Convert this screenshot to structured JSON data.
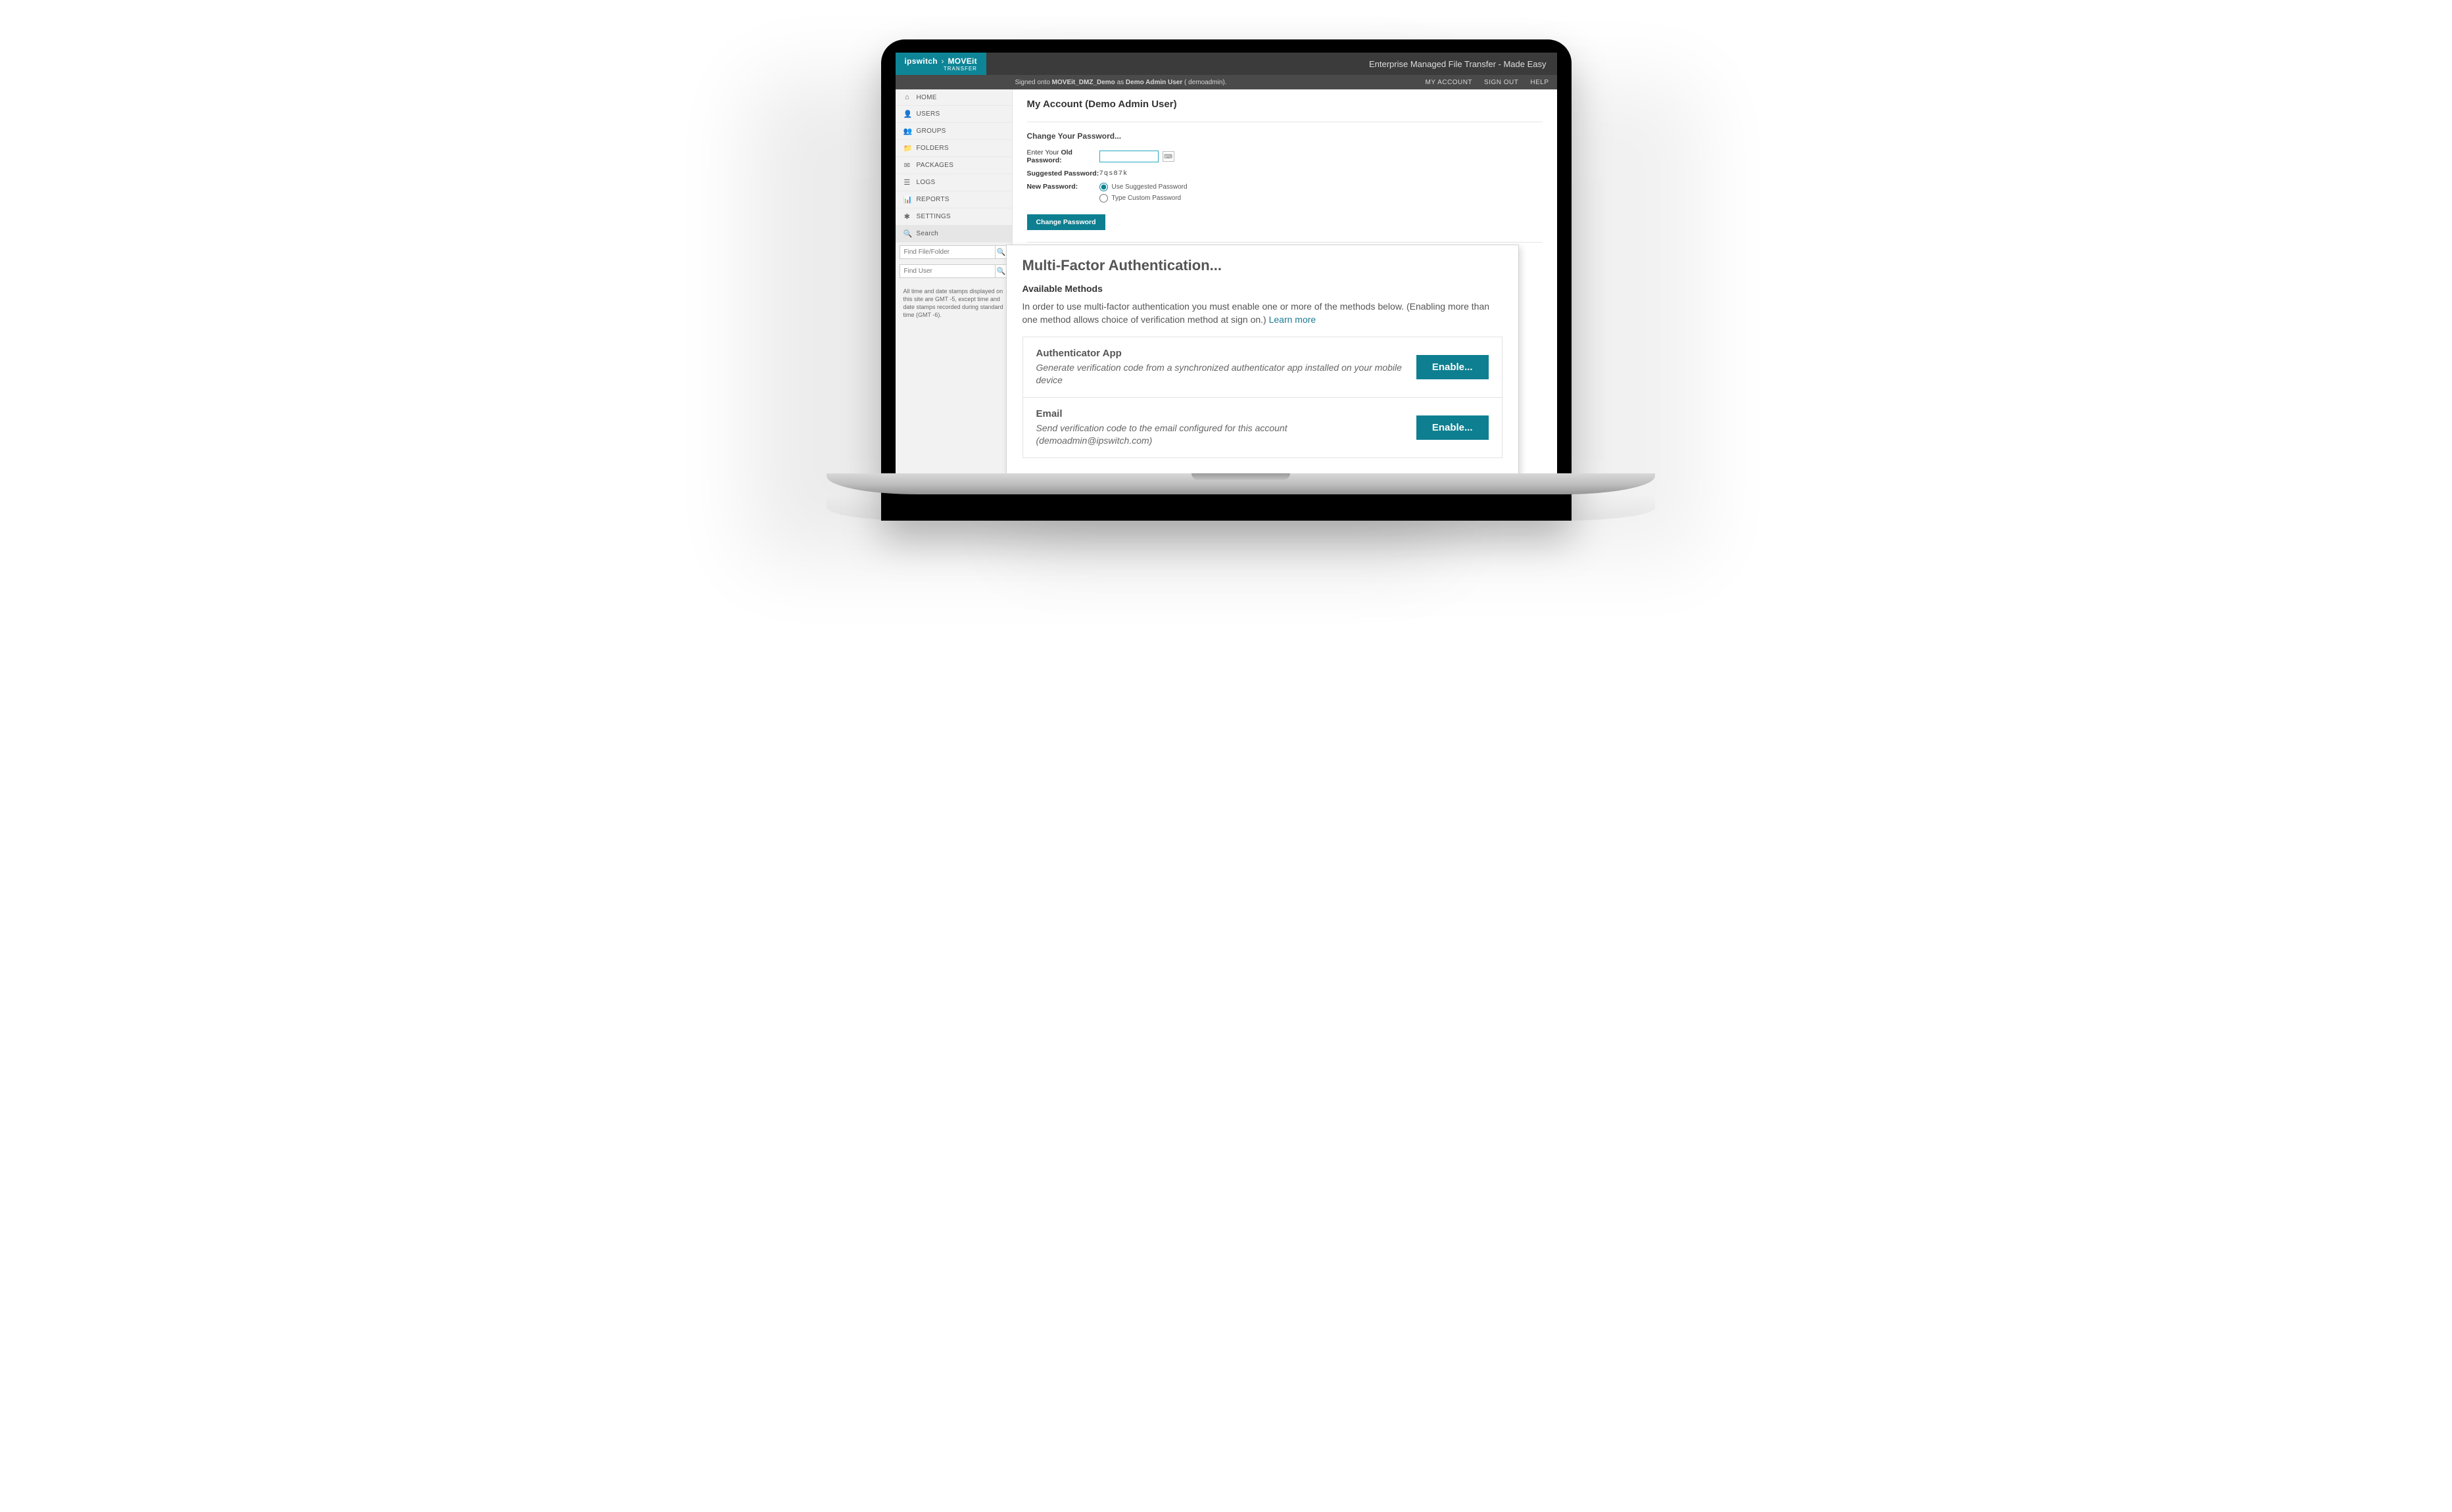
{
  "brand": {
    "line1a": "ipswitch",
    "line1b": "MOVEit",
    "line2": "TRANSFER"
  },
  "topbar_title": "Enterprise Managed File Transfer - Made Easy",
  "subbar": {
    "status_prefix": "Signed onto ",
    "status_org": "MOVEit_DMZ_Demo",
    "status_as": " as ",
    "status_user": "Demo Admin User",
    "status_paren": " ( demoadmin).",
    "links": {
      "account": "MY ACCOUNT",
      "signout": "SIGN OUT",
      "help": "HELP"
    }
  },
  "sidebar": {
    "items": [
      {
        "label": "HOME"
      },
      {
        "label": "USERS"
      },
      {
        "label": "GROUPS"
      },
      {
        "label": "FOLDERS"
      },
      {
        "label": "PACKAGES"
      },
      {
        "label": "LOGS"
      },
      {
        "label": "REPORTS"
      },
      {
        "label": "SETTINGS"
      }
    ],
    "search_label": "Search",
    "find_file_placeholder": "Find File/Folder",
    "find_user_placeholder": "Find User",
    "tz_note": "All time and date stamps displayed on this site are GMT -5, except time and date stamps recorded during standard time (GMT -6)."
  },
  "main": {
    "page_title": "My Account (Demo Admin User)",
    "change_pw_heading": "Change Your Password...",
    "old_pw_label_a": "Enter Your ",
    "old_pw_label_b": "Old Password:",
    "suggested_label": "Suggested Password:",
    "suggested_value": "7qs87k",
    "new_pw_label": "New Password:",
    "radio_use": "Use Suggested Password",
    "radio_custom": "Type Custom Password",
    "change_btn": "Change Password",
    "mfa_small_heading": "Multi-Factor Authentication..."
  },
  "mfa": {
    "title": "Multi-Factor Authentication...",
    "subheading": "Available Methods",
    "desc_a": "In order to use multi-factor authentication you must enable one or more of the methods below. (Enabling more than one method allows choice of verification method at sign on.) ",
    "learn_more": "Learn more",
    "methods": [
      {
        "name": "Authenticator App",
        "detail": "Generate verification code from a synchronized authenticator app installed on your mobile device",
        "btn": "Enable..."
      },
      {
        "name": "Email",
        "detail": "Send verification code to the email configured for this account (demoadmin@ipswitch.com)",
        "btn": "Enable..."
      }
    ]
  }
}
